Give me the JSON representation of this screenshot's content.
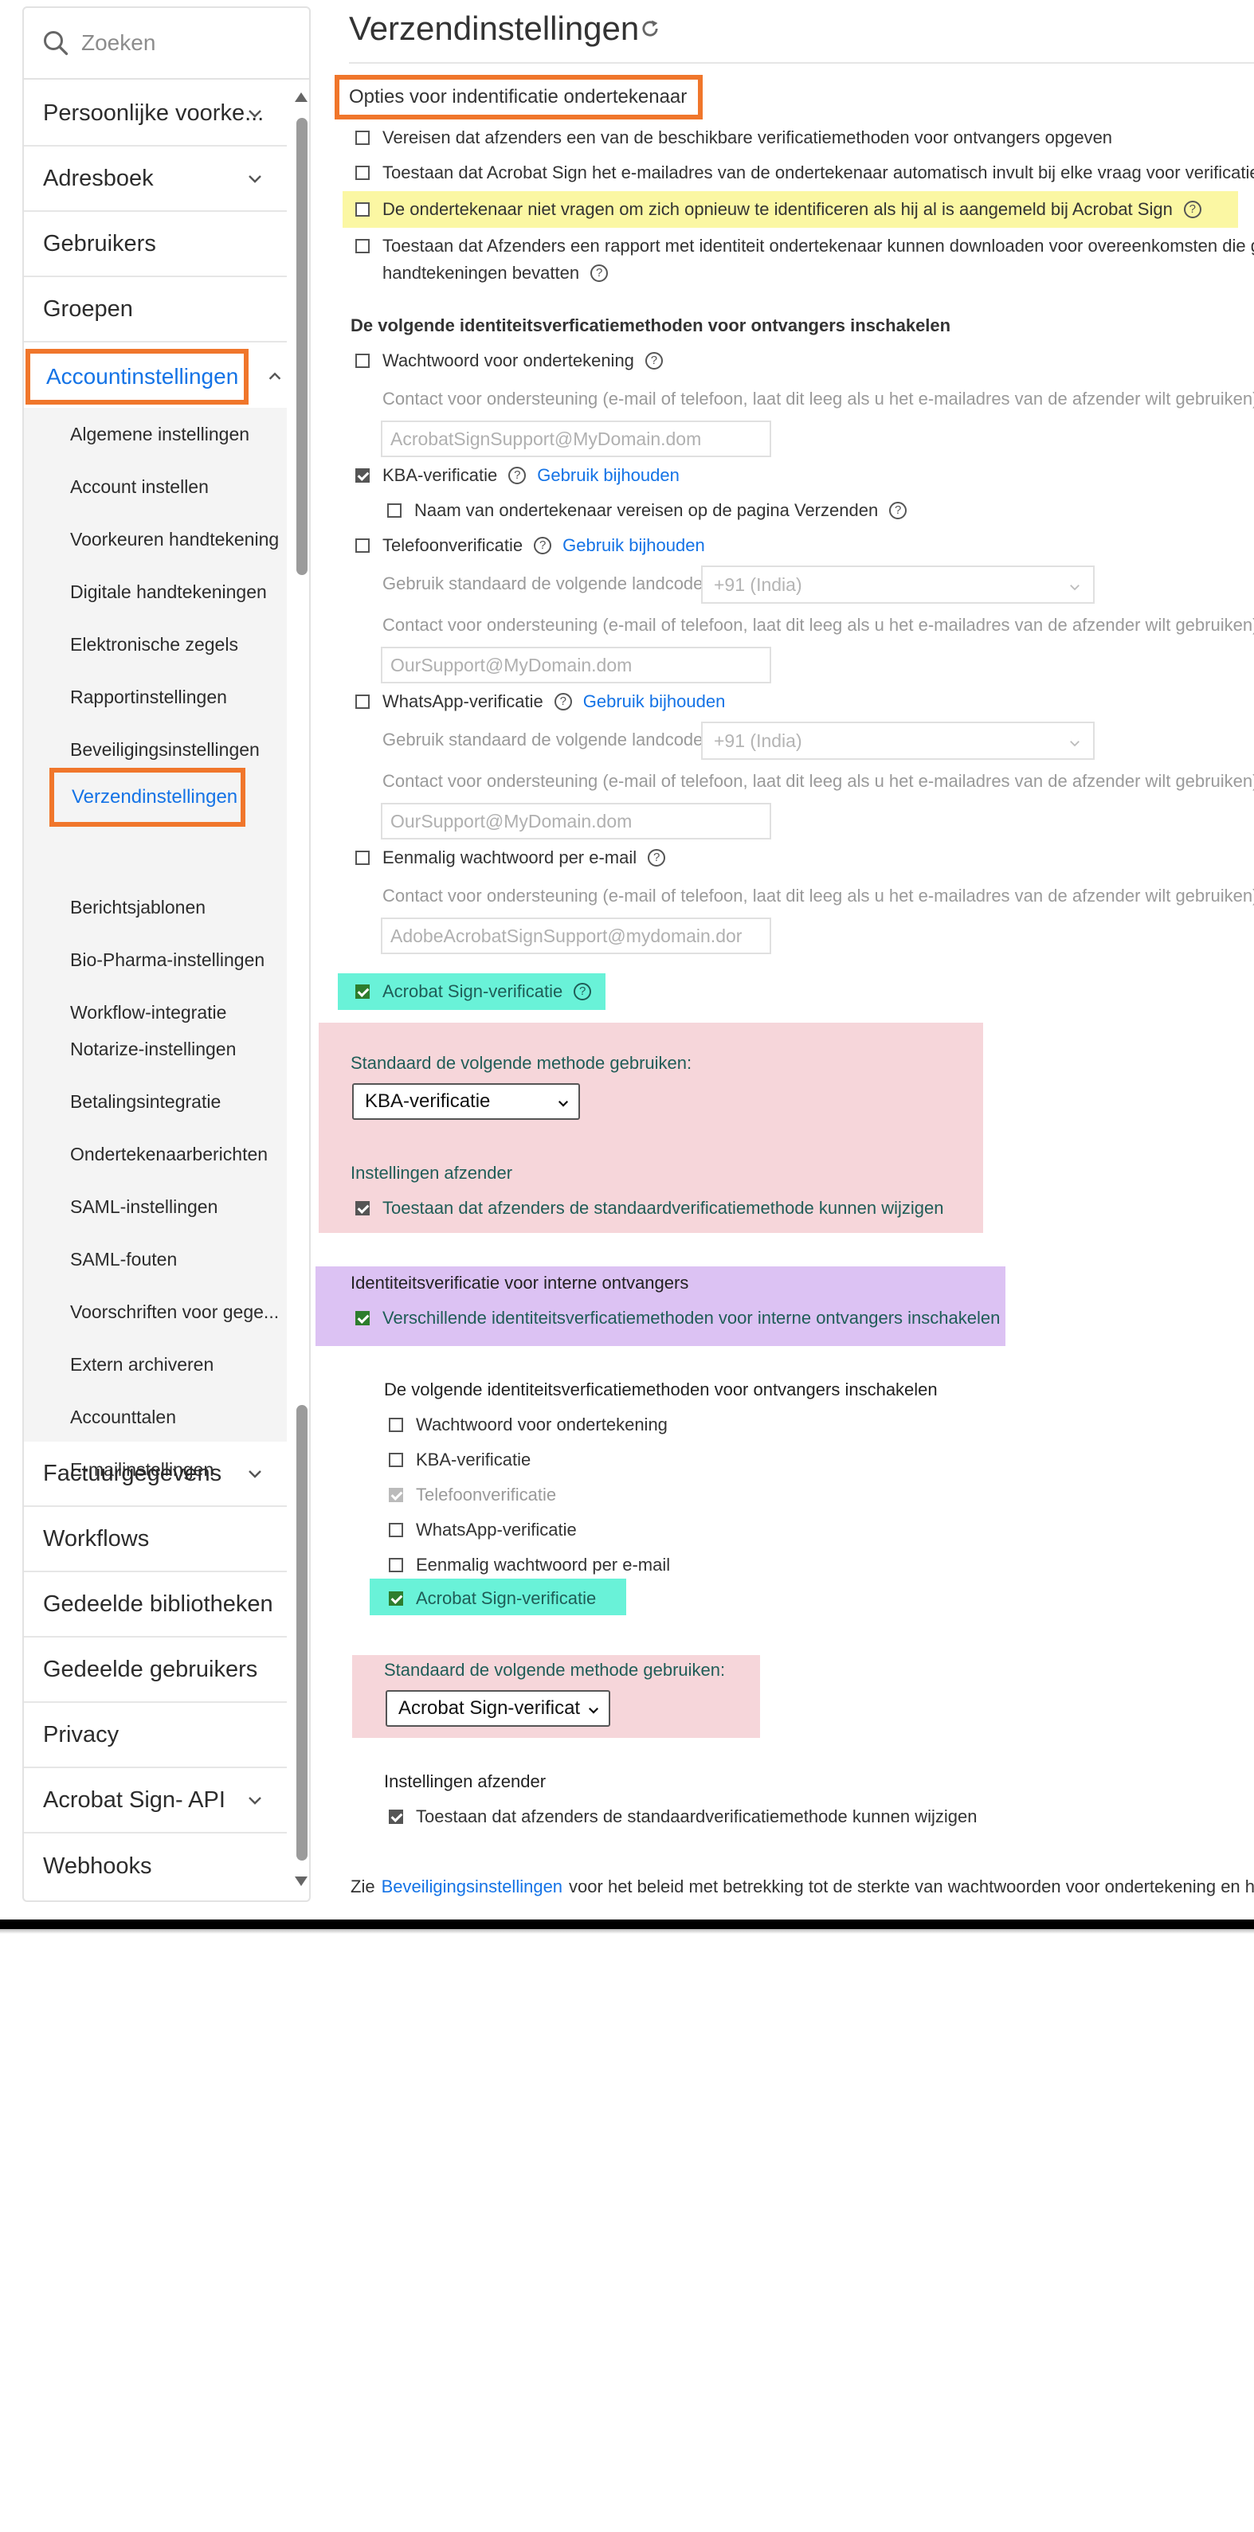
{
  "sidebar": {
    "search_placeholder": "Zoeken",
    "top_items": [
      {
        "label": "Persoonlijke voorke..."
      },
      {
        "label": "Adresboek"
      },
      {
        "label": "Gebruikers"
      },
      {
        "label": "Groepen"
      }
    ],
    "active_section": "Accountinstellingen",
    "sub_items": [
      "Algemene instellingen",
      "Account instellen",
      "Voorkeuren handtekening",
      "Digitale handtekeningen",
      "Elektronische zegels",
      "Rapportinstellingen",
      "Beveiligingsinstellingen",
      "Verzendinstellingen",
      "Berichtsjablonen",
      "Bio-Pharma-instellingen",
      "Workflow-integratie",
      "Notarize-instellingen",
      "Betalingsintegratie",
      "Ondertekenaarberichten",
      "SAML-instellingen",
      "SAML-fouten",
      "Voorschriften voor gege...",
      "Extern archiveren",
      "Accounttalen",
      "E-mailinstellingen"
    ],
    "bottom_items": [
      {
        "label": "Factuurgegevens"
      },
      {
        "label": "Workflows"
      },
      {
        "label": "Gedeelde bibliotheken"
      },
      {
        "label": "Gedeelde gebruikers"
      },
      {
        "label": "Privacy"
      },
      {
        "label": "Acrobat Sign- API"
      },
      {
        "label": "Webhooks"
      }
    ]
  },
  "main": {
    "title": "Verzendinstellingen",
    "section_title": "Opties voor indentificatie ondertekenaar",
    "options": [
      {
        "label": "Vereisen dat afzenders een van de beschikbare verificatiemethoden voor ontvangers opgeven",
        "checked": false
      },
      {
        "label": "Toestaan dat Acrobat Sign het e-mailadres van de ondertekenaar automatisch invult bij elke vraag voor verificatie",
        "checked": false
      },
      {
        "label": "De ondertekenaar niet vragen om zich opnieuw te identificeren als hij al is aangemeld bij Acrobat Sign",
        "checked": false
      },
      {
        "label_line1": "Toestaan dat Afzenders een rapport met identiteit ondertekenaar kunnen downloaden voor overeenkomsten die g",
        "label_line2": "handtekeningen bevatten",
        "checked": false
      }
    ],
    "methods_heading": "De volgende identiteitsverficatiemethoden voor ontvangers inschakelen",
    "support_contact_label": "Contact voor ondersteuning (e-mail of telefoon, laat dit leeg als u het e-mailadres van de afzender wilt gebruiken):",
    "country_label": "Gebruik standaard de volgende landcode:",
    "track_usage": "Gebruik bijhouden",
    "methods": {
      "password": {
        "label": "Wachtwoord voor ondertekening",
        "checked": false,
        "contact_placeholder": "AcrobatSignSupport@MyDomain.dom"
      },
      "kba": {
        "label": "KBA-verificatie",
        "checked": true,
        "sub_label": "Naam van ondertekenaar vereisen op de pagina Verzenden",
        "sub_checked": false
      },
      "phone": {
        "label": "Telefoonverificatie",
        "checked": false,
        "country": "+91 (India)",
        "contact_placeholder": "OurSupport@MyDomain.dom"
      },
      "whatsapp": {
        "label": "WhatsApp-verificatie",
        "checked": false,
        "country": "+91 (India)",
        "contact_placeholder": "OurSupport@MyDomain.dom"
      },
      "otp": {
        "label": "Eenmalig wachtwoord per e-mail",
        "checked": false,
        "contact_placeholder": "AdobeAcrobatSignSupport@mydomain.dor"
      },
      "acrobat_sign": {
        "label": "Acrobat Sign-verificatie",
        "checked": true
      }
    },
    "default_method_label": "Standaard de volgende methode gebruiken:",
    "default_method_value": "KBA-verificatie",
    "sender_settings_heading": "Instellingen afzender",
    "sender_allow_label": "Toestaan dat afzenders de standaardverificatiemethode kunnen wijzigen",
    "internal": {
      "heading": "Identiteitsverificatie voor interne ontvangers",
      "enable_label": "Verschillende identiteitsverficatiemethoden voor interne ontvangers inschakelen",
      "methods_heading": "De volgende identiteitsverficatiemethoden voor ontvangers inschakelen",
      "methods": [
        {
          "label": "Wachtwoord voor ondertekening",
          "state": "unchecked"
        },
        {
          "label": "KBA-verificatie",
          "state": "unchecked"
        },
        {
          "label": "Telefoonverificatie",
          "state": "disabled-checked"
        },
        {
          "label": "WhatsApp-verificatie",
          "state": "unchecked"
        },
        {
          "label": "Eenmalig wachtwoord per e-mail",
          "state": "unchecked"
        },
        {
          "label": "Acrobat Sign-verificatie",
          "state": "checked"
        }
      ],
      "default_method_label": "Standaard de volgende methode gebruiken:",
      "default_method_value": "Acrobat Sign-verificat",
      "sender_settings_heading": "Instellingen afzender",
      "sender_allow_label": "Toestaan dat afzenders de standaardverificatiemethode kunnen wijzigen"
    },
    "footer": {
      "prefix": "Zie",
      "link": "Beveiligingsinstellingen",
      "suffix": "voor het beleid met betrekking tot de sterkte van wachtwoorden voor ondertekening en he"
    }
  },
  "colors": {
    "annotation_orange": "#f0762b",
    "highlight_yellow": "#fbf7a3",
    "highlight_teal": "#69f2d8",
    "highlight_pink": "#f6d6da",
    "highlight_purple": "#dcc2f3",
    "link_blue": "#1473e6"
  }
}
